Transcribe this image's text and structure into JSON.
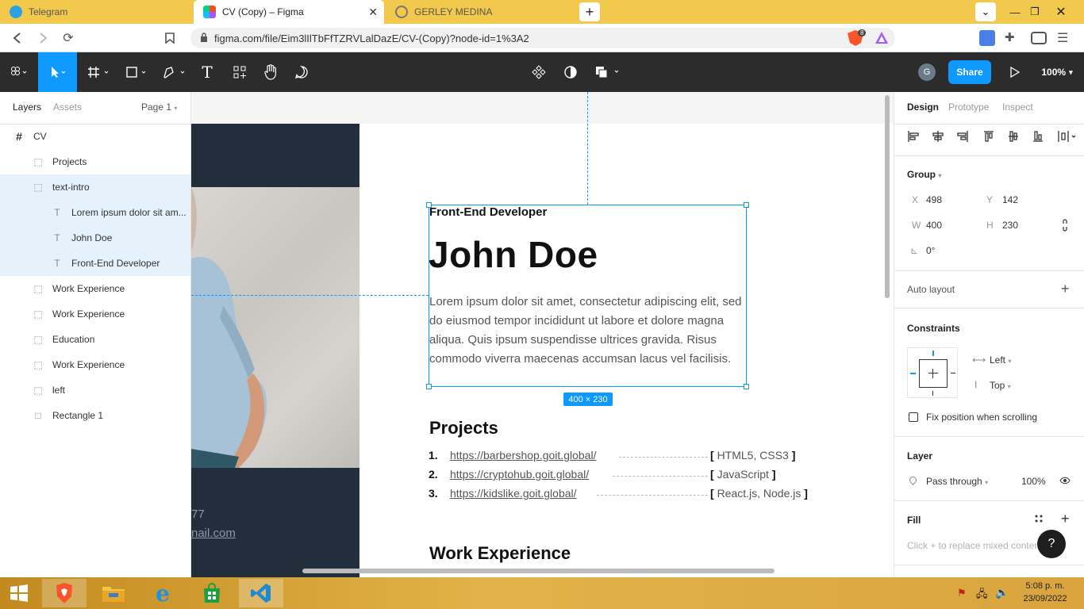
{
  "browser": {
    "tabs": [
      {
        "title": "Telegram",
        "active": false
      },
      {
        "title": "CV (Copy) – Figma",
        "active": true
      },
      {
        "title": "GERLEY MEDINA",
        "active": false
      }
    ],
    "new_tab": "+",
    "url": "figma.com/file/Eim3lIlTbFfTZRVLalDazE/CV-(Copy)?node-id=1%3A2",
    "brave_badge": "8"
  },
  "figma_toolbar": {
    "avatar_initial": "G",
    "share_label": "Share",
    "zoom": "100%"
  },
  "left_panel": {
    "tabs": [
      "Layers",
      "Assets"
    ],
    "page_selector": "Page 1",
    "layers": [
      {
        "name": "CV",
        "icon": "frame-icon",
        "indent": 0,
        "highlight": false
      },
      {
        "name": "Projects",
        "icon": "group-icon",
        "indent": 1,
        "highlight": false
      },
      {
        "name": "text-intro",
        "icon": "group-icon",
        "indent": 1,
        "highlight": true
      },
      {
        "name": "Lorem ipsum dolor sit am...",
        "icon": "text-icon",
        "indent": 2,
        "highlight": true
      },
      {
        "name": "John Doe",
        "icon": "text-icon",
        "indent": 2,
        "highlight": true
      },
      {
        "name": "Front-End Developer",
        "icon": "text-icon",
        "indent": 2,
        "highlight": true
      },
      {
        "name": "Work Experience",
        "icon": "group-icon",
        "indent": 1,
        "highlight": false
      },
      {
        "name": "Work Experience",
        "icon": "group-icon",
        "indent": 1,
        "highlight": false
      },
      {
        "name": "Education",
        "icon": "group-icon",
        "indent": 1,
        "highlight": false
      },
      {
        "name": "Work Experience",
        "icon": "group-icon",
        "indent": 1,
        "highlight": false
      },
      {
        "name": "left",
        "icon": "group-icon",
        "indent": 1,
        "highlight": false
      },
      {
        "name": "Rectangle 1",
        "icon": "rectangle-icon",
        "indent": 1,
        "highlight": false
      }
    ]
  },
  "canvas": {
    "subtitle": "Front-End Developer",
    "name": "John Doe",
    "intro": "Lorem ipsum dolor sit amet, consectetur adipiscing elit, sed do eiusmod tempor incididunt ut labore et dolore magna aliqua. Quis ipsum suspendisse ultrices gravida. Risus commodo viverra maecenas accumsan lacus vel facilisis.",
    "selection_size": "400 × 230",
    "projects_heading": "Projects",
    "projects": [
      {
        "num": "1.",
        "url": "https://barbershop.goit.global/",
        "tags": "HTML5, CSS3"
      },
      {
        "num": "2.",
        "url": "https://cryptohub.goit.global/",
        "tags": "JavaScript"
      },
      {
        "num": "3.",
        "url": "https://kidslike.goit.global/",
        "tags": "React.js, Node.js"
      }
    ],
    "work_heading": "Work Experience",
    "left_phone_fragment": "77",
    "left_email_fragment": "nail.com"
  },
  "right_panel": {
    "tabs": [
      "Design",
      "Prototype",
      "Inspect"
    ],
    "group_label": "Group",
    "x_label": "X",
    "x_value": "498",
    "y_label": "Y",
    "y_value": "142",
    "w_label": "W",
    "w_value": "400",
    "h_label": "H",
    "h_value": "230",
    "rotation": "0°",
    "auto_layout": "Auto layout",
    "constraints": "Constraints",
    "constraint_h": "Left",
    "constraint_v": "Top",
    "fix_position": "Fix position when scrolling",
    "layer": "Layer",
    "blend_mode": "Pass through",
    "opacity": "100%",
    "fill": "Fill",
    "fill_hint": "Click + to replace mixed content",
    "help": "?"
  },
  "taskbar": {
    "time": "5:08 p. m.",
    "date": "23/09/2022"
  },
  "colors": {
    "figma_blue": "#0d99ff",
    "toolbar_dark": "#2c2c2c",
    "cv_dark": "#222e3c",
    "browser_chrome": "#f2c94c"
  }
}
